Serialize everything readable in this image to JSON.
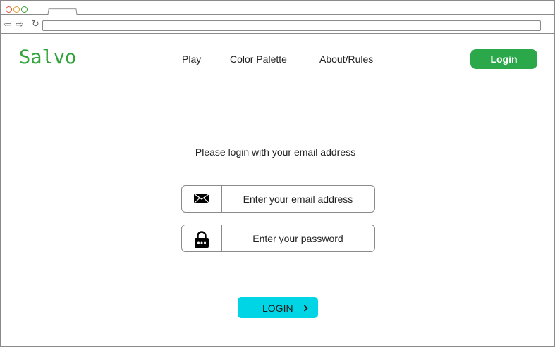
{
  "browser": {
    "icons": [
      "back-arrow-icon",
      "forward-arrow-icon",
      "reload-icon"
    ],
    "url": ""
  },
  "header": {
    "logo": "Salvo",
    "nav": [
      {
        "label": "Play"
      },
      {
        "label": "Color Palette"
      },
      {
        "label": "About/Rules"
      }
    ],
    "login_button": "Login"
  },
  "form": {
    "prompt": "Please login with your email address",
    "email_placeholder": "Enter your email address",
    "password_placeholder": "Enter your password",
    "submit_label": "LOGIN",
    "icons": [
      "envelope-icon",
      "lock-icon",
      "chevron-right-icon"
    ]
  },
  "colors": {
    "brand_green": "#31a33a",
    "login_green": "#2aa84a",
    "cta_cyan": "#00d5e6"
  }
}
